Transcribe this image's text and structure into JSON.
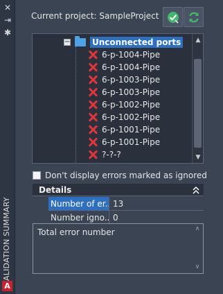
{
  "side_panel": {
    "title": "VALIDATION SUMMARY",
    "logo_letter": "A",
    "close_icon": "close-icon",
    "pin_icon": "auto-hide-icon",
    "settings_icon": "gear-icon"
  },
  "header": {
    "project_label": "Current project: SampleProject",
    "validate_icon": "validate-check-icon",
    "refresh_icon": "refresh-icon"
  },
  "tree": {
    "root_label": "Unconnected ports",
    "items": [
      "6-p-1004-Pipe",
      "6-p-1004-Pipe",
      "6-p-1003-Pipe",
      "6-p-1003-Pipe",
      "6-p-1002-Pipe",
      "6-p-1002-Pipe",
      "6-p-1001-Pipe",
      "6-p-1001-Pipe",
      "?-?-?",
      "?-?-?"
    ]
  },
  "ignore_checkbox": {
    "label": "Don't display errors marked as ignored",
    "checked": false
  },
  "details": {
    "title": "Details",
    "rows": [
      {
        "name": "Number of er...",
        "value": "13",
        "selected": true
      },
      {
        "name": "Number igno...",
        "value": "0",
        "selected": false
      }
    ],
    "description": "Total error number"
  },
  "colors": {
    "background": "#3b4453",
    "selection": "#2d6fc0",
    "error_icon": "#e2343a",
    "validate_button": "#3fb86b"
  }
}
